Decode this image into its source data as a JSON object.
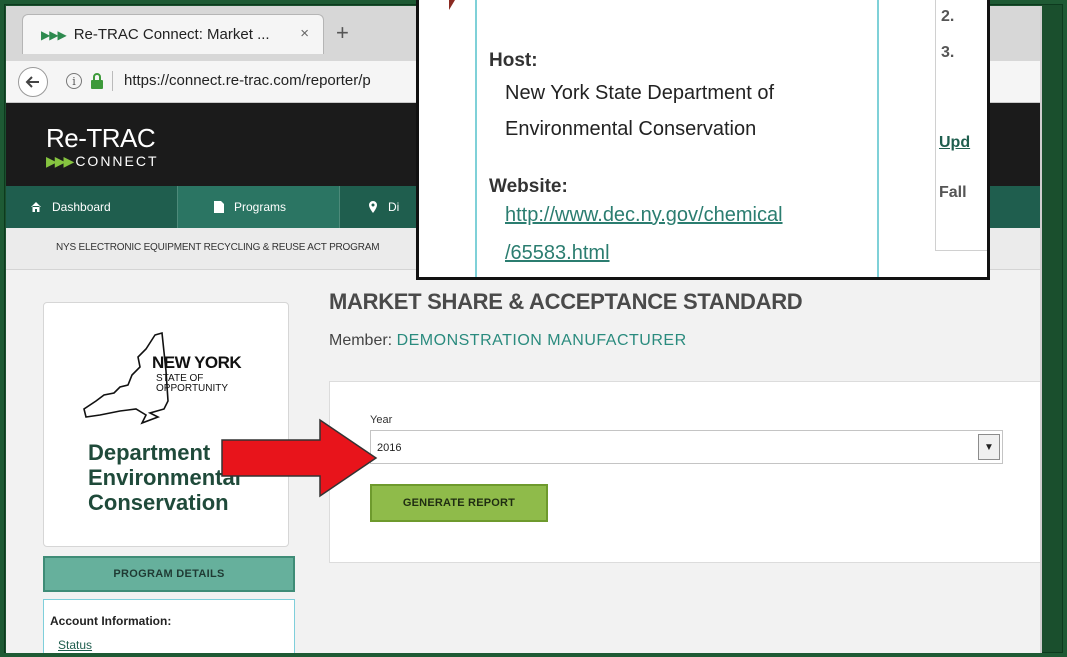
{
  "browser": {
    "tab_favicon": "▶▶▶",
    "tab_title": "Re-TRAC Connect: Market ...",
    "tab_close": "×",
    "new_tab": "+",
    "url": "https://connect.re-trac.com/reporter/p"
  },
  "site": {
    "logo_main": "Re-TRAC",
    "logo_arrows": "▶▶▶",
    "logo_sub": "CONNECT"
  },
  "nav": {
    "dashboard": "Dashboard",
    "programs": "Programs",
    "directory_partial": "Di"
  },
  "breadcrumb": "NYS ELECTRONIC EQUIPMENT RECYCLING & REUSE ACT PROGRAM",
  "sidebar": {
    "state_name": "NEW YORK",
    "state_tag1": "STATE OF",
    "state_tag2": "OPPORTUNITY",
    "dept_name": "Department\nEnvironmental\nConservation",
    "program_details": "PROGRAM DETAILS",
    "account_title": "Account Information:",
    "status_link": "Status"
  },
  "main": {
    "title": "MARKET SHARE & ACCEPTANCE STANDARD",
    "member_label": "Member:",
    "member_value": "DEMONSTRATION MANUFACTURER",
    "year_label": "Year",
    "year_value": "2016",
    "generate_button": "GENERATE REPORT"
  },
  "callout": {
    "host_label": "Host:",
    "host_line1": "New York State Department of",
    "host_line2": "Environmental Conservation",
    "website_label": "Website:",
    "website_line1": "http://www.dec.ny.gov/chemical",
    "website_line2": "/65583.html",
    "right_num1": "2.",
    "right_num2": "3.",
    "right_link": "Upd",
    "right_text": "Fall"
  },
  "colors": {
    "nav_bg": "#1f5e4e",
    "accent_teal": "#2a8b7e",
    "generate_green": "#8fbb4a",
    "arrow_red": "#e8141b",
    "slide_bg": "#1a4f2d"
  }
}
